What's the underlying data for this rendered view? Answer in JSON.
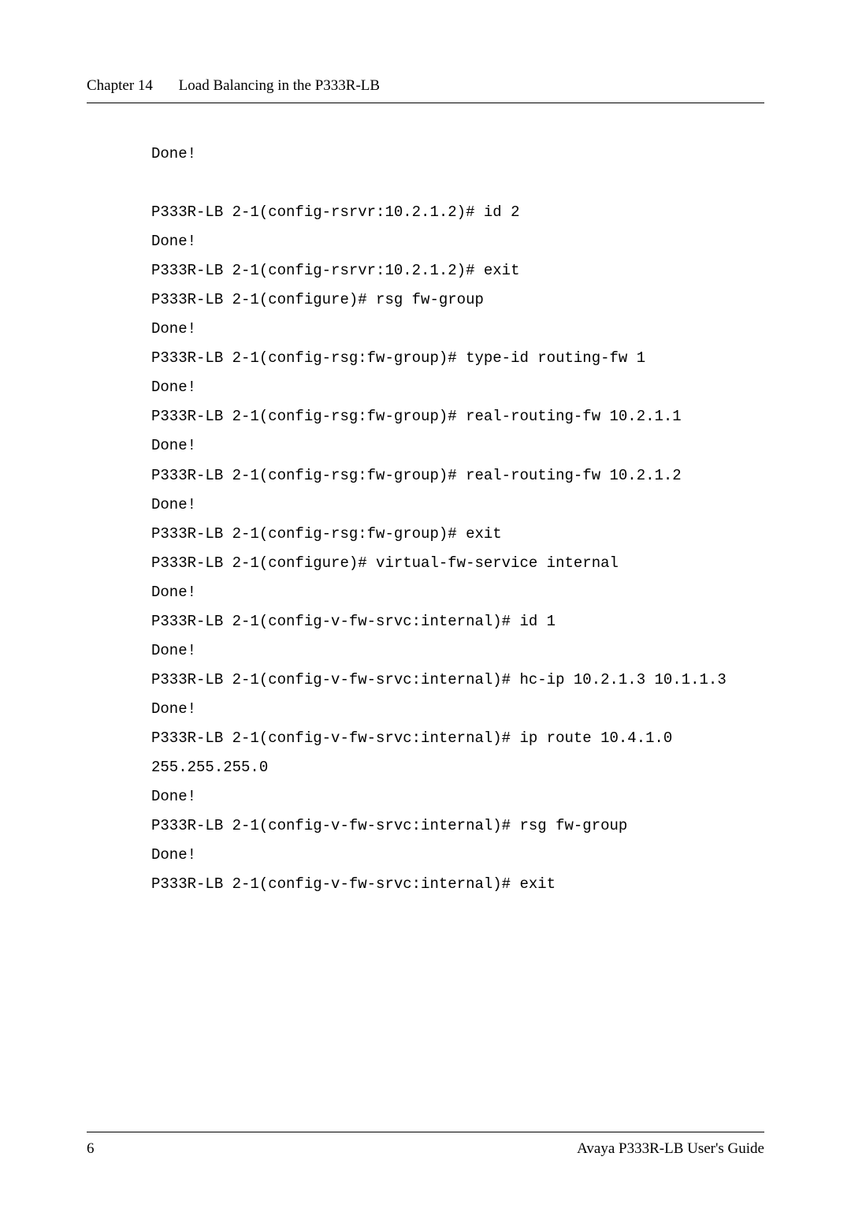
{
  "header": {
    "chapter_label": "Chapter 14",
    "chapter_title": "Load Balancing in the P333R-LB"
  },
  "lines": [
    "Done!",
    "",
    "P333R-LB 2-1(config-rsrvr:10.2.1.2)# id 2",
    "Done!",
    "P333R-LB 2-1(config-rsrvr:10.2.1.2)# exit",
    "P333R-LB 2-1(configure)# rsg fw-group",
    "Done!",
    "P333R-LB 2-1(config-rsg:fw-group)# type-id routing-fw 1",
    "Done!",
    "P333R-LB 2-1(config-rsg:fw-group)# real-routing-fw 10.2.1.1",
    "Done!",
    "P333R-LB 2-1(config-rsg:fw-group)# real-routing-fw 10.2.1.2",
    "Done!",
    "P333R-LB 2-1(config-rsg:fw-group)# exit",
    "P333R-LB 2-1(configure)# virtual-fw-service internal",
    "Done!",
    "P333R-LB 2-1(config-v-fw-srvc:internal)# id 1",
    "Done!",
    "P333R-LB 2-1(config-v-fw-srvc:internal)# hc-ip 10.2.1.3 10.1.1.3",
    "Done!",
    "P333R-LB 2-1(config-v-fw-srvc:internal)# ip route 10.4.1.0 255.255.255.0",
    "Done!",
    "P333R-LB 2-1(config-v-fw-srvc:internal)# rsg fw-group",
    "Done!",
    "P333R-LB 2-1(config-v-fw-srvc:internal)# exit"
  ],
  "footer": {
    "page_number": "6",
    "doc_title": "Avaya P333R-LB User's Guide"
  }
}
